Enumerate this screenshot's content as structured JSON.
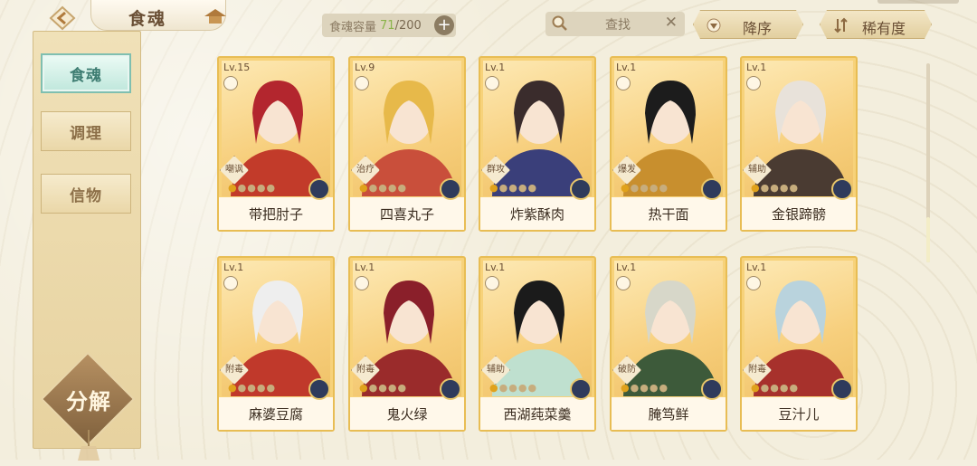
{
  "header": {
    "title": "食魂",
    "capacity_label": "食魂容量",
    "capacity_current": "71",
    "capacity_total": "/200",
    "capacity_add": "+",
    "search_placeholder": "查找",
    "search_clear": "✕",
    "sort_order_label": "降序",
    "sort_by_label": "稀有度"
  },
  "sidebar": {
    "items": [
      {
        "label": "食魂",
        "active": true
      },
      {
        "label": "调理",
        "active": false
      },
      {
        "label": "信物",
        "active": false
      }
    ],
    "decompose_label": "分解"
  },
  "cards": [
    {
      "level": "Lv.15",
      "role": "嘲讽",
      "name": "带把肘子",
      "stars": 1,
      "hair": "#b3262e",
      "coat": "#c23b2a"
    },
    {
      "level": "Lv.9",
      "role": "治疗",
      "name": "四喜丸子",
      "stars": 1,
      "hair": "#e7b94a",
      "coat": "#c94f3b"
    },
    {
      "level": "Lv.1",
      "role": "群攻",
      "name": "炸紫酥肉",
      "stars": 1,
      "hair": "#3a2c2c",
      "coat": "#3a3f7a"
    },
    {
      "level": "Lv.1",
      "role": "爆发",
      "name": "热干面",
      "stars": 1,
      "hair": "#1c1c1c",
      "coat": "#c88f2e"
    },
    {
      "level": "Lv.1",
      "role": "辅助",
      "name": "金银蹄髈",
      "stars": 1,
      "hair": "#e8e2da",
      "coat": "#4a3b32"
    },
    {
      "level": "Lv.1",
      "role": "附毒",
      "name": "麻婆豆腐",
      "stars": 1,
      "hair": "#eeeeee",
      "coat": "#c0392b"
    },
    {
      "level": "Lv.1",
      "role": "附毒",
      "name": "鬼火绿",
      "stars": 1,
      "hair": "#8a1f2a",
      "coat": "#9a2b2b"
    },
    {
      "level": "Lv.1",
      "role": "辅助",
      "name": "西湖莼菜羹",
      "stars": 1,
      "hair": "#1b1b1b",
      "coat": "#bfe0cf"
    },
    {
      "level": "Lv.1",
      "role": "破防",
      "name": "腌笃鲜",
      "stars": 1,
      "hair": "#d7d7c9",
      "coat": "#3d5a3a"
    },
    {
      "level": "Lv.1",
      "role": "附毒",
      "name": "豆汁儿",
      "stars": 1,
      "hair": "#b9d3dd",
      "coat": "#a7312c"
    }
  ]
}
